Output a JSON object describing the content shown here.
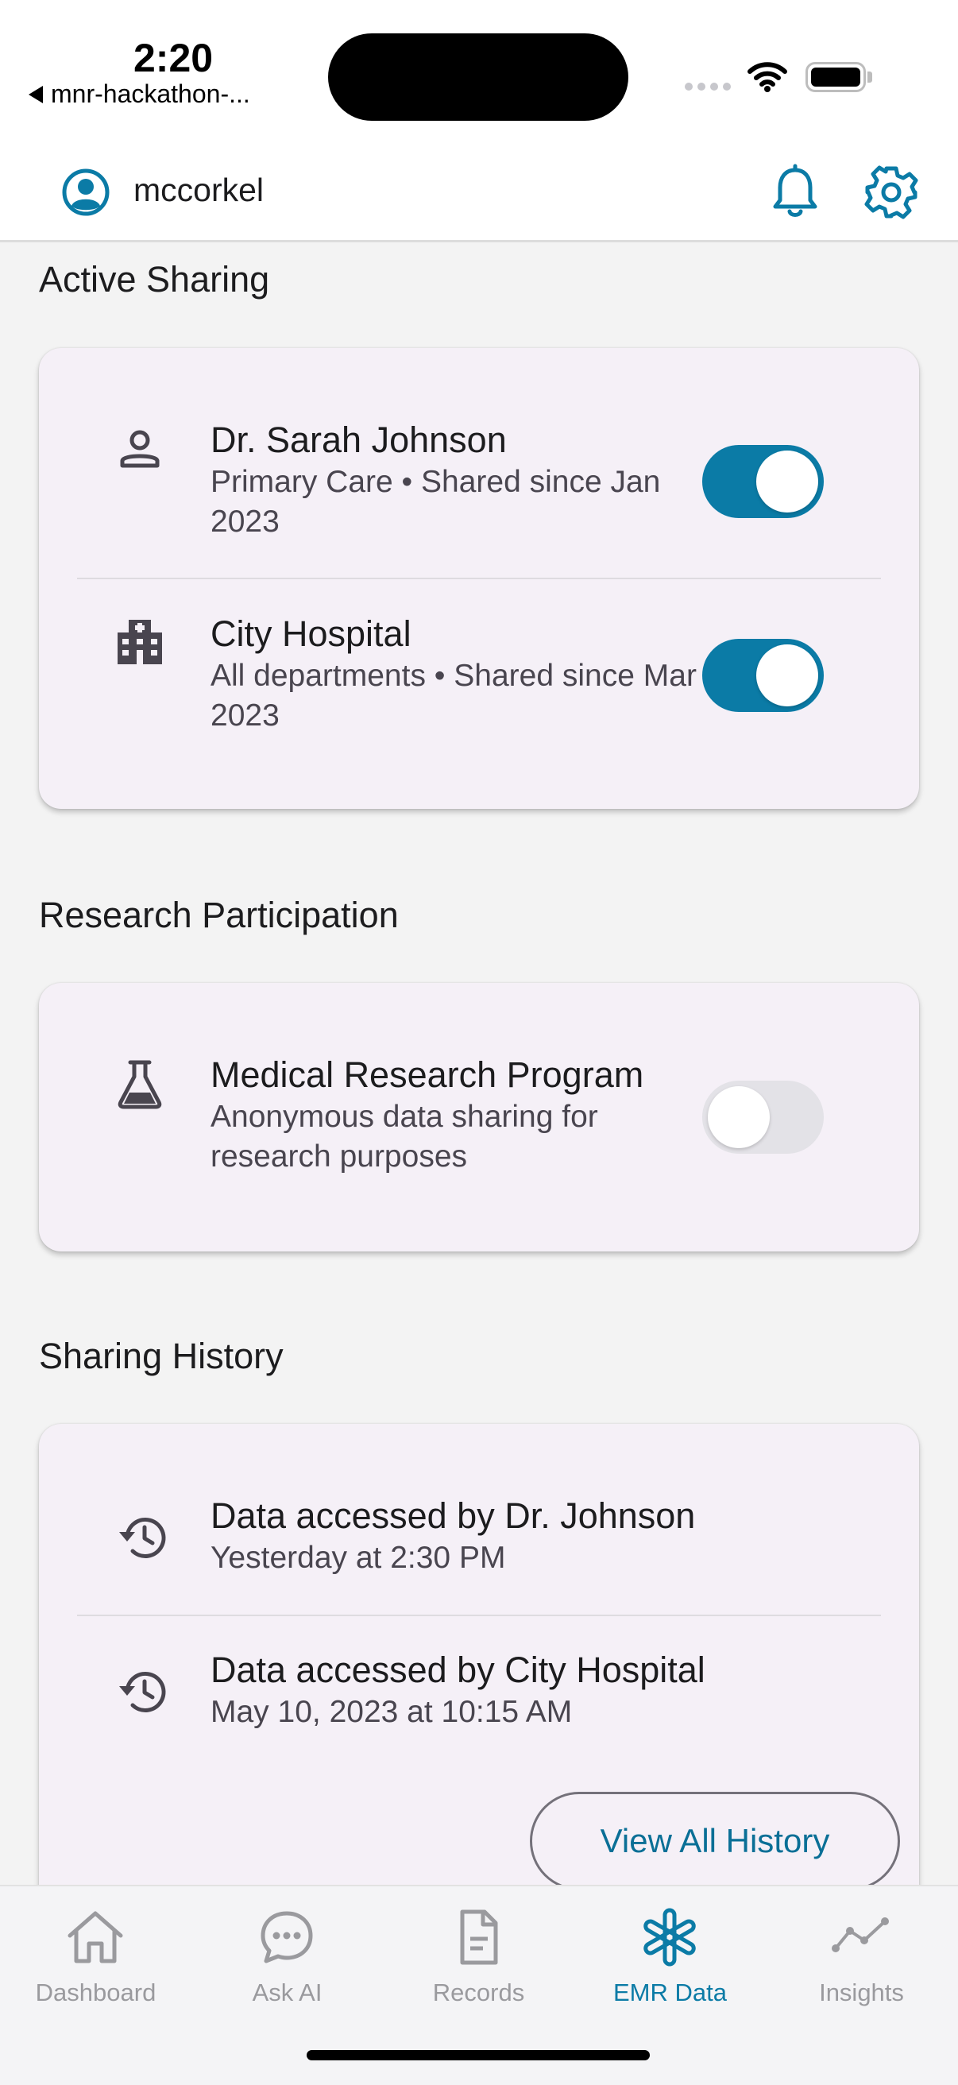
{
  "status_bar": {
    "time": "2:20",
    "back_app": "mnr-hackathon-..."
  },
  "header": {
    "username": "mccorkel"
  },
  "active_sharing": {
    "title": "Active Sharing",
    "items": [
      {
        "name": "Dr. Sarah Johnson",
        "detail": "Primary Care • Shared since Jan 2023",
        "icon": "person-icon",
        "enabled": true
      },
      {
        "name": "City Hospital",
        "detail": "All departments • Shared since Mar 2023",
        "icon": "hospital-icon",
        "enabled": true
      }
    ]
  },
  "research": {
    "title": "Research Participation",
    "items": [
      {
        "name": "Medical Research Program",
        "detail": "Anonymous data sharing for research purposes",
        "icon": "flask-icon",
        "enabled": false
      }
    ]
  },
  "history": {
    "title": "Sharing History",
    "items": [
      {
        "name": "Data accessed by Dr. Johnson",
        "detail": "Yesterday at 2:30 PM",
        "icon": "history-icon"
      },
      {
        "name": "Data accessed by City Hospital",
        "detail": "May 10, 2023 at 10:15 AM",
        "icon": "history-icon"
      }
    ],
    "view_all_label": "View All History"
  },
  "bottom_nav": {
    "items": [
      {
        "label": "Dashboard",
        "icon": "home-icon",
        "active": false
      },
      {
        "label": "Ask AI",
        "icon": "chat-bubble-icon",
        "active": false
      },
      {
        "label": "Records",
        "icon": "document-icon",
        "active": false
      },
      {
        "label": "EMR Data",
        "icon": "asterisk-icon",
        "active": true
      },
      {
        "label": "Insights",
        "icon": "trend-line-icon",
        "active": false
      }
    ]
  },
  "colors": {
    "accent": "#0b7ba6",
    "card_background": "#f5f0f7",
    "page_background": "#f3f3f3",
    "inactive_nav": "#9a9a9e"
  }
}
